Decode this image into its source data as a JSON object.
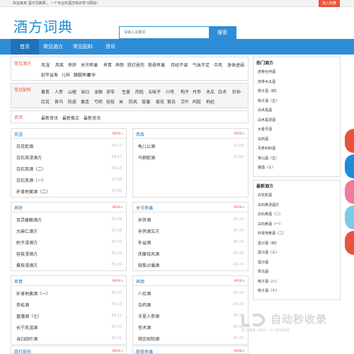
{
  "topbar": {
    "welcome": "欢迎来到 酒方词典网 ，一个专业的酒方知识学习网站！",
    "favorite": "加入收藏"
  },
  "header": {
    "logo": "酒方词典"
  },
  "search": {
    "placeholder": "请输入关键词",
    "button": "搜索"
  },
  "nav": {
    "items": [
      "首页",
      "常见酒方",
      "常见配料",
      "资讯"
    ],
    "active_index": 0
  },
  "common_recipes": {
    "label": "常见酒方",
    "tags": [
      "风湿",
      "风疾",
      "养肝",
      "关节疼痛",
      "养胃",
      "养颜",
      "跌打损伤",
      "筋骨疼痛",
      "月经不调",
      "气血不足",
      "中风",
      "身体虚弱",
      "延年益寿",
      "儿科",
      "腰腿疼痛",
      "不孕"
    ]
  },
  "common_ingredients": {
    "label": "常见配料",
    "tags": [
      "黄芪",
      "人参",
      "山楂",
      "当归",
      "龙眼",
      "茯苓",
      "生姜",
      "肉桂",
      "五味子",
      "川芎",
      "枸子",
      "丹参",
      "木瓜",
      "白术",
      "杜仲",
      "红花",
      "首乌",
      "防皮",
      "黄连",
      "芍药",
      "桂枝",
      "米",
      "防风",
      "苗蒲",
      "菊花",
      "紫苏",
      "艾叶",
      "阿胶",
      "枸杞"
    ]
  },
  "news_row": {
    "label": "资讯",
    "tags": [
      "最新资讯",
      "最新推文",
      "最新资讯"
    ]
  },
  "panels": [
    {
      "title": "风湿",
      "more": "MORE+",
      "items": [
        {
          "name": "白花蛇酒",
          "date": "08-17"
        },
        {
          "name": "白石英浸酒方",
          "date": "08-17"
        },
        {
          "name": "白石英酒（二）",
          "date": "08-18"
        },
        {
          "name": "白石英酒（一）",
          "date": "10-08"
        },
        {
          "name": "补肾地黄酒（二）",
          "date": "10-09"
        }
      ]
    },
    {
      "title": "风疾",
      "more": "MORE+",
      "items": [
        {
          "name": "龟儿公酒",
          "date": "11-08"
        },
        {
          "name": "乌梢蛇酒",
          "date": "11-06"
        }
      ]
    },
    {
      "title": "养肝",
      "more": "MORE+",
      "items": [
        {
          "name": "百灵藤酿酒方",
          "date": "05-28"
        },
        {
          "name": "大麻仁酒方",
          "date": "05-28"
        },
        {
          "name": "附子浸酒方",
          "date": "05-29"
        },
        {
          "name": "桂枝浸酒方",
          "date": "05-29"
        },
        {
          "name": "桑枝浸酒方",
          "date": "05-29"
        }
      ]
    },
    {
      "title": "关节疼痛",
      "more": "MORE+",
      "items": [
        {
          "name": "补肝酒",
          "date": "05-29"
        },
        {
          "name": "补肝酒又方",
          "date": "05-18"
        },
        {
          "name": "补益酒",
          "date": "05-19"
        },
        {
          "name": "庆藤祛风酒",
          "date": "05-18"
        },
        {
          "name": "吸筋止痛酒",
          "date": "05-20"
        }
      ]
    },
    {
      "title": "养胃",
      "more": "MORE+",
      "items": [
        {
          "name": "补肾地黄酒（一）",
          "date": "05-20"
        },
        {
          "name": "参松酒",
          "date": "05-23"
        },
        {
          "name": "菖蒲酒（七）",
          "date": "05-21"
        },
        {
          "name": "长宁风湿酒",
          "date": "05-20"
        },
        {
          "name": "当归四叶酒",
          "date": "05-21"
        }
      ]
    },
    {
      "title": "养颜",
      "more": "MORE+",
      "items": [
        {
          "name": "八珍酒",
          "date": "05-20"
        },
        {
          "name": "白药酒",
          "date": "05-20"
        },
        {
          "name": "半夏人参酒",
          "date": "05-21"
        },
        {
          "name": "苍术酒",
          "date": "05-20"
        },
        {
          "name": "桃实助阳酒",
          "date": "05-20"
        }
      ]
    },
    {
      "title": "跌打损伤",
      "more": "MORE+",
      "items": []
    },
    {
      "title": "筋骨疼痛",
      "more": "MORE+",
      "items": []
    }
  ],
  "sidebar": {
    "hot_title": "热门酒方",
    "hot_items": [
      "虎骨杜仲酒",
      "虎骨木瓜酒",
      "枸子酒（四）",
      "枸子酒（五）",
      "白术黑酒",
      "白术黑浸酒",
      "大金牙酒",
      "白药酒",
      "丹参石斛酒",
      "常山酒（五）",
      "猴酒（三）"
    ],
    "new_title": "最新酒方",
    "new_items": [
      "白花蛇酒",
      "白石英浸酒方",
      "白石英酒（二）",
      "白石英酒（一）",
      "补肾地黄酒（二）",
      "蛋沙酒（四）",
      "蛋沙酒（三）",
      "蛋沙酒",
      "草乌酒",
      "枸子酒（八）",
      "枸子酒（十）"
    ]
  },
  "float_colors": [
    "#e8543b",
    "#1f8bd8",
    "#f27a9c",
    "#7dc9e8",
    "#e8543b"
  ],
  "watermark": {
    "text": "自动秒收录",
    "sub": "做上链接→来访一次→自动收录"
  }
}
